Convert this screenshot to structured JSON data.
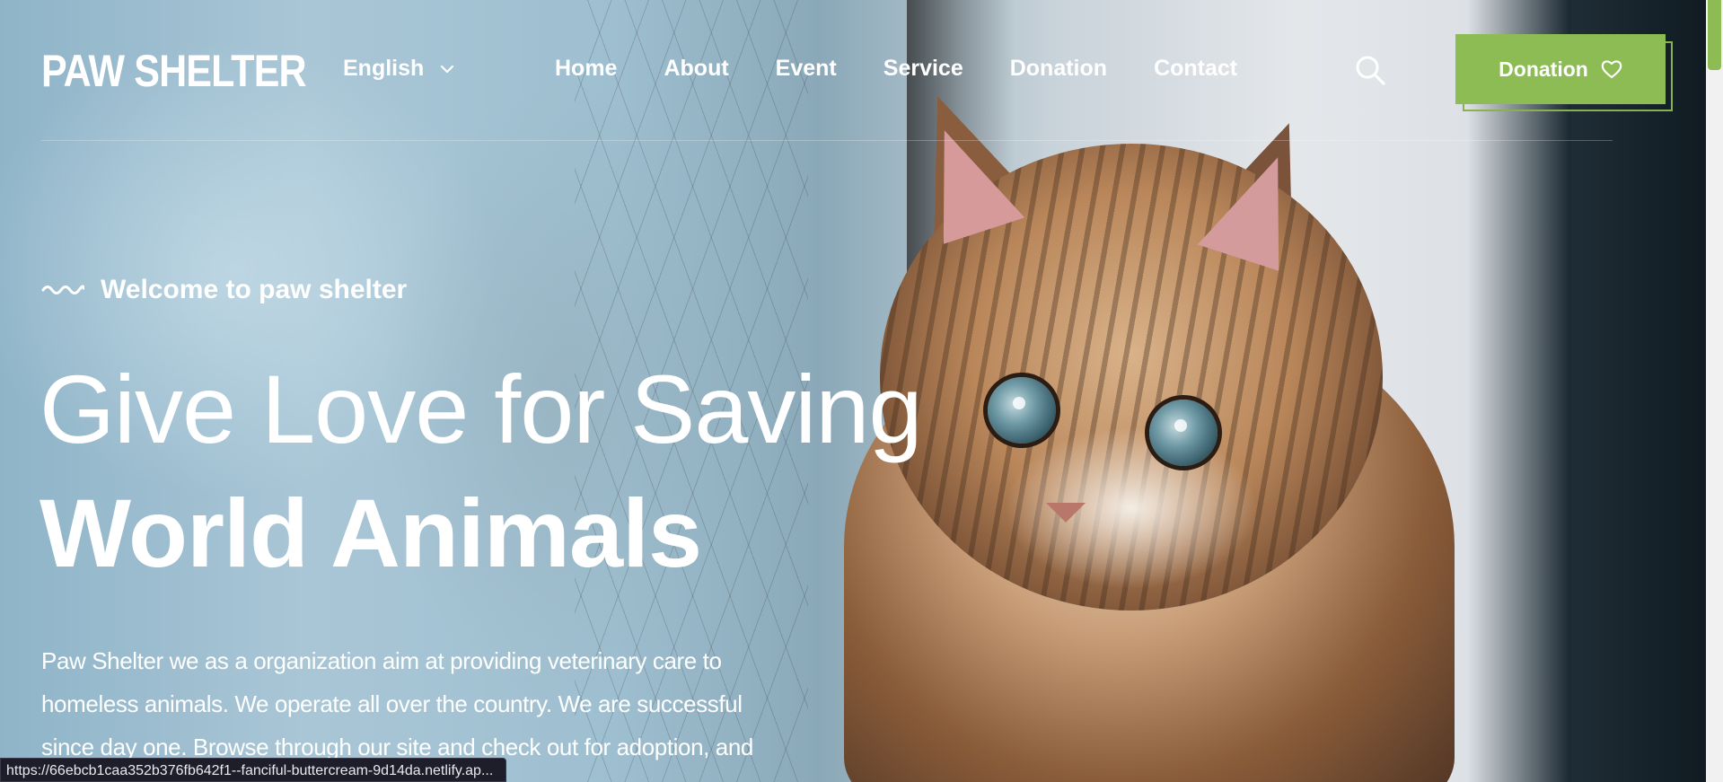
{
  "header": {
    "logo": "PAW SHELTER",
    "language": {
      "selected": "English",
      "icon": "chevron-down-icon"
    },
    "nav": [
      {
        "label": "Home"
      },
      {
        "label": "About"
      },
      {
        "label": "Event"
      },
      {
        "label": "Service"
      },
      {
        "label": "Donation"
      },
      {
        "label": "Contact"
      }
    ],
    "search_icon": "search-icon",
    "donate_button": {
      "label": "Donation",
      "icon": "heart-icon"
    }
  },
  "hero": {
    "eyebrow": "Welcome to paw shelter",
    "headline_line1": "Give Love for Saving",
    "headline_line2": "World Animals",
    "description": "Paw Shelter we as a organization aim at providing veterinary care to homeless animals. We operate all over the country. We are successful since day one. Browse through our site and check out for adoption, and"
  },
  "status_bar": {
    "url": "https://66ebcb1caa352b376fb642f1--fanciful-buttercream-9d14da.netlify.ap..."
  },
  "colors": {
    "accent": "#8dbb54",
    "text": "#ffffff"
  }
}
